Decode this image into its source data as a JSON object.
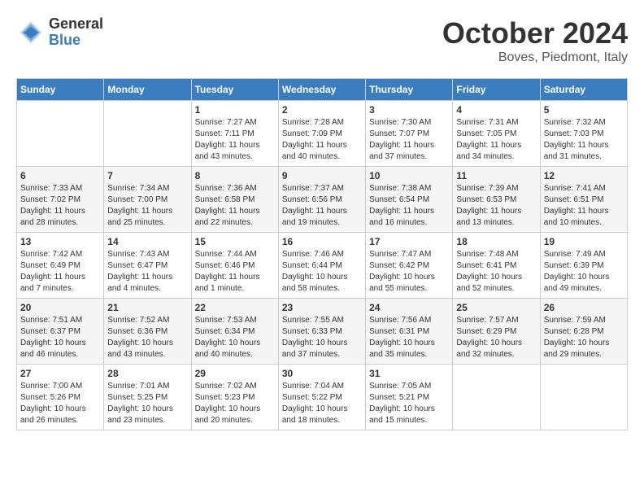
{
  "header": {
    "logo_general": "General",
    "logo_blue": "Blue",
    "month_title": "October 2024",
    "location": "Boves, Piedmont, Italy"
  },
  "days_of_week": [
    "Sunday",
    "Monday",
    "Tuesday",
    "Wednesday",
    "Thursday",
    "Friday",
    "Saturday"
  ],
  "weeks": [
    [
      {
        "day": "",
        "info": ""
      },
      {
        "day": "",
        "info": ""
      },
      {
        "day": "1",
        "info": "Sunrise: 7:27 AM\nSunset: 7:11 PM\nDaylight: 11 hours and 43 minutes."
      },
      {
        "day": "2",
        "info": "Sunrise: 7:28 AM\nSunset: 7:09 PM\nDaylight: 11 hours and 40 minutes."
      },
      {
        "day": "3",
        "info": "Sunrise: 7:30 AM\nSunset: 7:07 PM\nDaylight: 11 hours and 37 minutes."
      },
      {
        "day": "4",
        "info": "Sunrise: 7:31 AM\nSunset: 7:05 PM\nDaylight: 11 hours and 34 minutes."
      },
      {
        "day": "5",
        "info": "Sunrise: 7:32 AM\nSunset: 7:03 PM\nDaylight: 11 hours and 31 minutes."
      }
    ],
    [
      {
        "day": "6",
        "info": "Sunrise: 7:33 AM\nSunset: 7:02 PM\nDaylight: 11 hours and 28 minutes."
      },
      {
        "day": "7",
        "info": "Sunrise: 7:34 AM\nSunset: 7:00 PM\nDaylight: 11 hours and 25 minutes."
      },
      {
        "day": "8",
        "info": "Sunrise: 7:36 AM\nSunset: 6:58 PM\nDaylight: 11 hours and 22 minutes."
      },
      {
        "day": "9",
        "info": "Sunrise: 7:37 AM\nSunset: 6:56 PM\nDaylight: 11 hours and 19 minutes."
      },
      {
        "day": "10",
        "info": "Sunrise: 7:38 AM\nSunset: 6:54 PM\nDaylight: 11 hours and 16 minutes."
      },
      {
        "day": "11",
        "info": "Sunrise: 7:39 AM\nSunset: 6:53 PM\nDaylight: 11 hours and 13 minutes."
      },
      {
        "day": "12",
        "info": "Sunrise: 7:41 AM\nSunset: 6:51 PM\nDaylight: 11 hours and 10 minutes."
      }
    ],
    [
      {
        "day": "13",
        "info": "Sunrise: 7:42 AM\nSunset: 6:49 PM\nDaylight: 11 hours and 7 minutes."
      },
      {
        "day": "14",
        "info": "Sunrise: 7:43 AM\nSunset: 6:47 PM\nDaylight: 11 hours and 4 minutes."
      },
      {
        "day": "15",
        "info": "Sunrise: 7:44 AM\nSunset: 6:46 PM\nDaylight: 11 hours and 1 minute."
      },
      {
        "day": "16",
        "info": "Sunrise: 7:46 AM\nSunset: 6:44 PM\nDaylight: 10 hours and 58 minutes."
      },
      {
        "day": "17",
        "info": "Sunrise: 7:47 AM\nSunset: 6:42 PM\nDaylight: 10 hours and 55 minutes."
      },
      {
        "day": "18",
        "info": "Sunrise: 7:48 AM\nSunset: 6:41 PM\nDaylight: 10 hours and 52 minutes."
      },
      {
        "day": "19",
        "info": "Sunrise: 7:49 AM\nSunset: 6:39 PM\nDaylight: 10 hours and 49 minutes."
      }
    ],
    [
      {
        "day": "20",
        "info": "Sunrise: 7:51 AM\nSunset: 6:37 PM\nDaylight: 10 hours and 46 minutes."
      },
      {
        "day": "21",
        "info": "Sunrise: 7:52 AM\nSunset: 6:36 PM\nDaylight: 10 hours and 43 minutes."
      },
      {
        "day": "22",
        "info": "Sunrise: 7:53 AM\nSunset: 6:34 PM\nDaylight: 10 hours and 40 minutes."
      },
      {
        "day": "23",
        "info": "Sunrise: 7:55 AM\nSunset: 6:33 PM\nDaylight: 10 hours and 37 minutes."
      },
      {
        "day": "24",
        "info": "Sunrise: 7:56 AM\nSunset: 6:31 PM\nDaylight: 10 hours and 35 minutes."
      },
      {
        "day": "25",
        "info": "Sunrise: 7:57 AM\nSunset: 6:29 PM\nDaylight: 10 hours and 32 minutes."
      },
      {
        "day": "26",
        "info": "Sunrise: 7:59 AM\nSunset: 6:28 PM\nDaylight: 10 hours and 29 minutes."
      }
    ],
    [
      {
        "day": "27",
        "info": "Sunrise: 7:00 AM\nSunset: 5:26 PM\nDaylight: 10 hours and 26 minutes."
      },
      {
        "day": "28",
        "info": "Sunrise: 7:01 AM\nSunset: 5:25 PM\nDaylight: 10 hours and 23 minutes."
      },
      {
        "day": "29",
        "info": "Sunrise: 7:02 AM\nSunset: 5:23 PM\nDaylight: 10 hours and 20 minutes."
      },
      {
        "day": "30",
        "info": "Sunrise: 7:04 AM\nSunset: 5:22 PM\nDaylight: 10 hours and 18 minutes."
      },
      {
        "day": "31",
        "info": "Sunrise: 7:05 AM\nSunset: 5:21 PM\nDaylight: 10 hours and 15 minutes."
      },
      {
        "day": "",
        "info": ""
      },
      {
        "day": "",
        "info": ""
      }
    ]
  ]
}
